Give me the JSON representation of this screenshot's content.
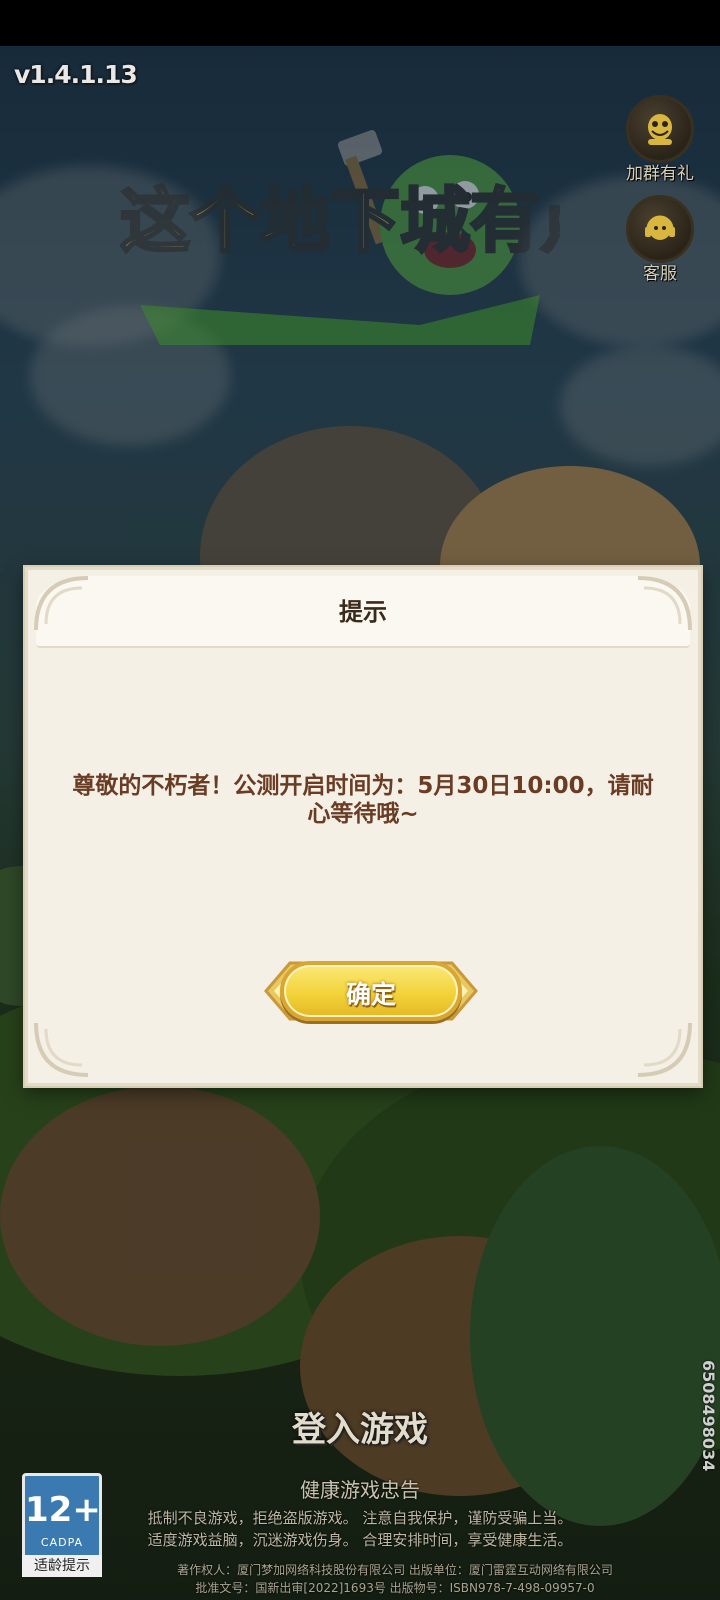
{
  "app": {
    "version": "v1.4.1.13",
    "logo_text": "这个地下城有点怪"
  },
  "side_buttons": [
    {
      "label": "加群有礼",
      "icon": "group-chat-icon"
    },
    {
      "label": "客服",
      "icon": "customer-service-icon"
    }
  ],
  "dialog": {
    "title": "提示",
    "message": "尊敬的不朽者！公测开启时间为：5月30日10:00，请耐心等待哦~",
    "confirm_label": "确定"
  },
  "login_label": "登入游戏",
  "health": {
    "title": "健康游戏忠告",
    "line1": "抵制不良游戏，拒绝盗版游戏。 注意自我保护，谨防受骗上当。",
    "line2": "适度游戏益脑，沉迷游戏伤身。 合理安排时间，享受健康生活。"
  },
  "legal": {
    "line1": "著作权人：厦门梦加网络科技股份有限公司 出版单位：厦门雷霆互动网络有限公司",
    "line2": "批准文号：国新出审[2022]1693号 出版物号：ISBN978-7-498-09957-0"
  },
  "age_rating": {
    "age": "12+",
    "org": "CADPA",
    "tip": "适龄提示"
  },
  "side_code": "6508498034",
  "colors": {
    "dialog_bg": "#f4f0e6",
    "message": "#6b3c24",
    "button": "#f3d33a"
  }
}
